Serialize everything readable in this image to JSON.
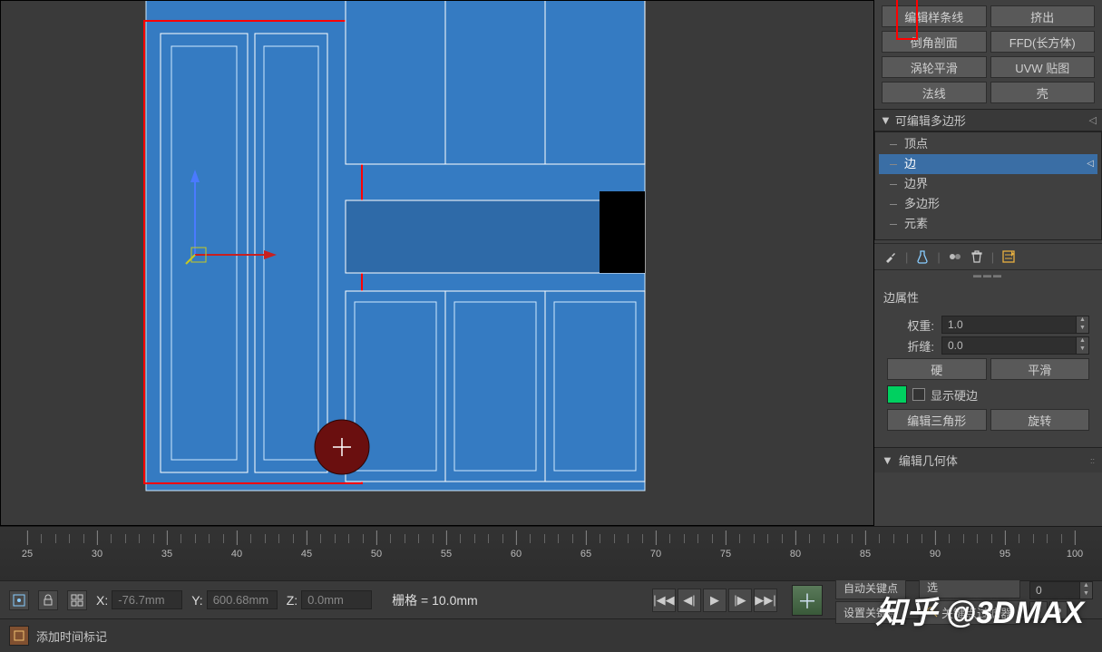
{
  "buttons": {
    "b1": "编辑样条线",
    "b2": "挤出",
    "b3": "倒角剖面",
    "b4": "FFD(长方体)",
    "b5": "涡轮平滑",
    "b6": "UVW 贴图",
    "b7": "法线",
    "b8": "壳"
  },
  "stack": {
    "title": "可编辑多边形",
    "items": [
      "顶点",
      "边",
      "边界",
      "多边形",
      "元素"
    ],
    "selected_index": 1
  },
  "edge_props": {
    "title": "边属性",
    "weight_label": "权重:",
    "weight_val": "1.0",
    "crease_label": "折缝:",
    "crease_val": "0.0",
    "hard": "硬",
    "smooth": "平滑",
    "show_hard": "显示硬边",
    "edit_tri": "编辑三角形",
    "turn": "旋转"
  },
  "rollout_geo": "编辑几何体",
  "coords": {
    "x": "-76.7mm",
    "y": "600.68mm",
    "z": "0.0mm"
  },
  "grid_label": "栅格 = 10.0mm",
  "auto_key": "自动关键点",
  "set_key": "设置关键点",
  "sel_filter_pre": "选",
  "key_filter": "关键点过滤器",
  "add_time_marker": "添加时间标记",
  "frame": "0",
  "ruler_ticks": [
    25,
    30,
    35,
    40,
    45,
    50,
    55,
    60,
    65,
    70,
    75,
    80,
    85,
    90,
    95,
    100
  ],
  "watermark": "知乎 @3DMAX"
}
